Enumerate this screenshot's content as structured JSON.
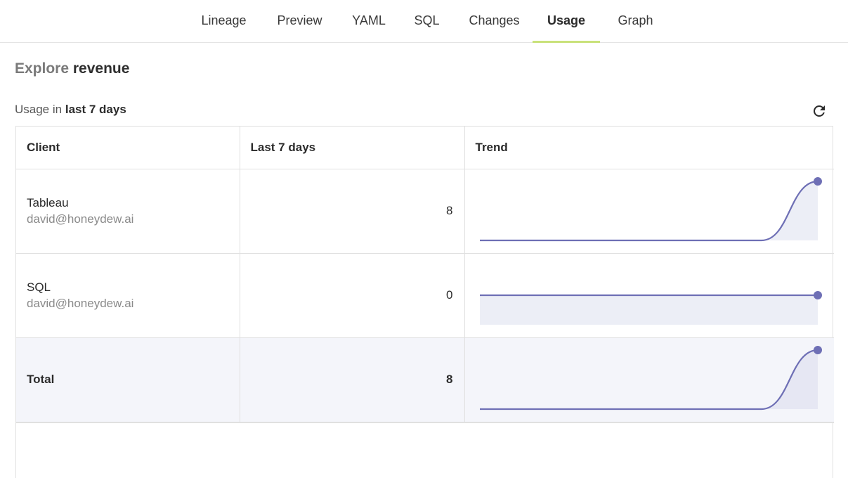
{
  "tabs": [
    {
      "label": "Lineage",
      "active": false
    },
    {
      "label": "Preview",
      "active": false
    },
    {
      "label": "YAML",
      "active": false
    },
    {
      "label": "SQL",
      "active": false
    },
    {
      "label": "Changes",
      "active": false
    },
    {
      "label": "Usage",
      "active": true
    },
    {
      "label": "Graph",
      "active": false
    }
  ],
  "header": {
    "title_prefix": "Explore",
    "title_entity": "revenue",
    "usage_prefix": "Usage in",
    "usage_period": "last 7 days",
    "refresh_icon": "refresh-icon"
  },
  "table": {
    "columns": [
      "Client",
      "Last 7 days",
      "Trend"
    ],
    "rows": [
      {
        "client": "Tableau",
        "user": "david@honeydew.ai",
        "count": "8",
        "trend": [
          0,
          0,
          0,
          0,
          0,
          0,
          8
        ]
      },
      {
        "client": "SQL",
        "user": "david@honeydew.ai",
        "count": "0",
        "trend": [
          0,
          0,
          0,
          0,
          0,
          0,
          0
        ]
      }
    ],
    "total": {
      "label": "Total",
      "count": "8",
      "trend": [
        0,
        0,
        0,
        0,
        0,
        0,
        8
      ]
    }
  },
  "colors": {
    "line": "#6e6fb5",
    "fill": "#eceef6",
    "fill_total": "#e6e7f3",
    "tab_indicator": "#c9e27a"
  }
}
